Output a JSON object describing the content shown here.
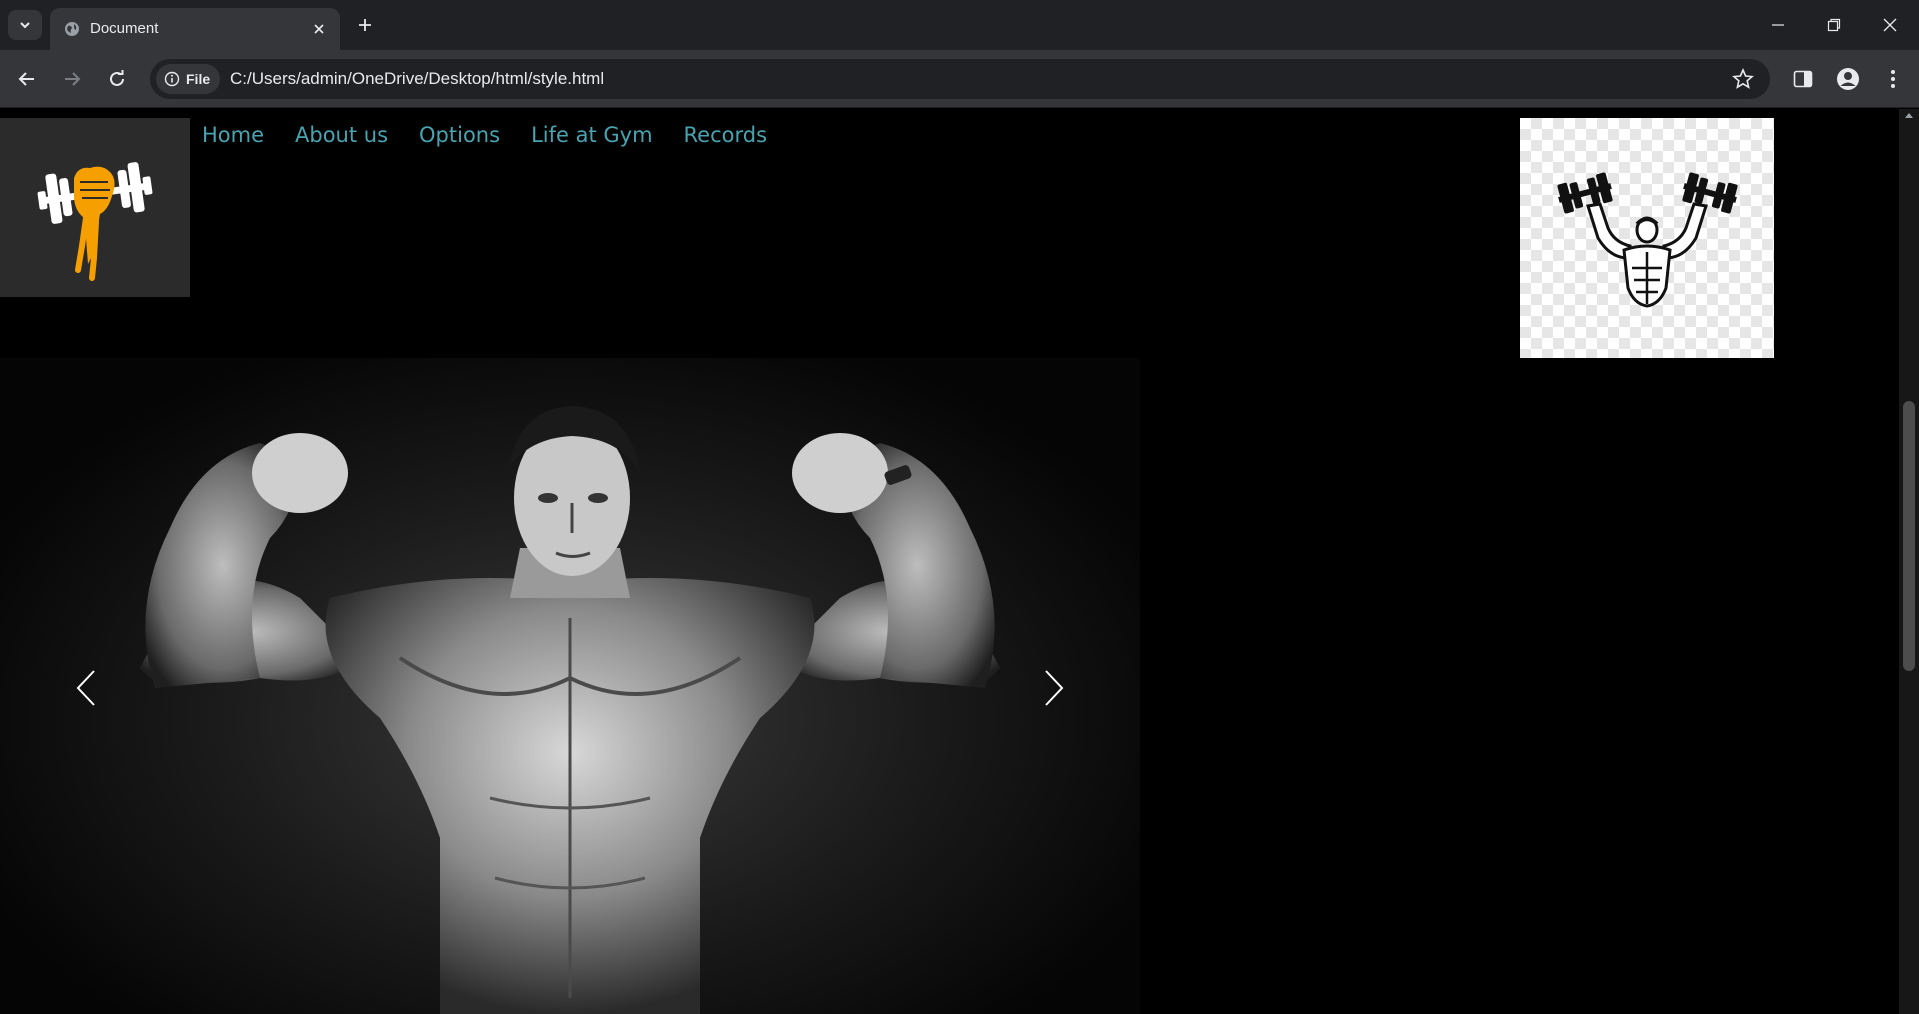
{
  "browser": {
    "tab_title": "Document",
    "site_chip_label": "File",
    "url": "C:/Users/admin/OneDrive/Desktop/html/style.html"
  },
  "page": {
    "nav": {
      "items": [
        {
          "label": "Home"
        },
        {
          "label": "About us"
        },
        {
          "label": "Options"
        },
        {
          "label": "Life at Gym"
        },
        {
          "label": "Records"
        }
      ]
    },
    "logo_icon": "fist-dumbbell-logo",
    "side_image_icon": "bodybuilder-dumbbells-clipart",
    "carousel": {
      "image_subject": "bodybuilder-double-biceps-photo",
      "prev_icon": "chevron-left-icon",
      "next_icon": "chevron-right-icon"
    }
  },
  "colors": {
    "nav_link": "#4aa3b0",
    "logo_accent": "#f5a000",
    "page_bg": "#000000",
    "chrome_dark": "#202124",
    "chrome_toolbar": "#35363a"
  }
}
